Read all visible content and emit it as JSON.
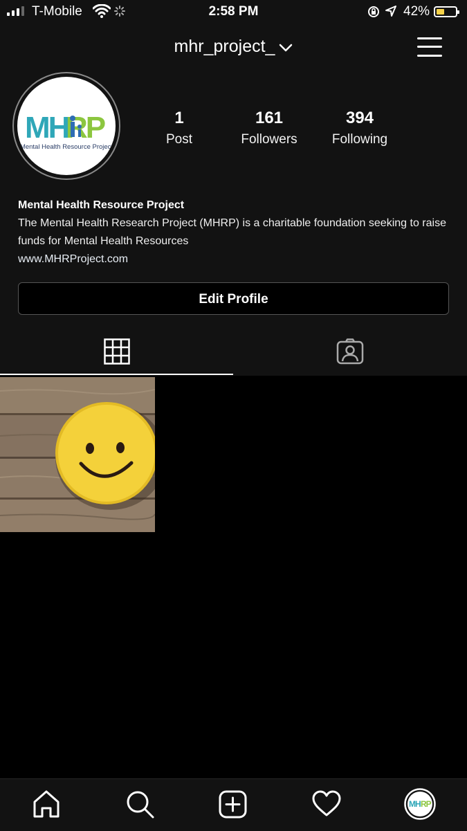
{
  "status_bar": {
    "carrier": "T-Mobile",
    "time": "2:58 PM",
    "battery": "42%",
    "battery_level": 0.42
  },
  "header": {
    "username": "mhr_project_"
  },
  "profile": {
    "avatar_logo": "MHRP",
    "avatar_caption": "Mental Health Resource Project",
    "stats": [
      {
        "value": "1",
        "label": "Post"
      },
      {
        "value": "161",
        "label": "Followers"
      },
      {
        "value": "394",
        "label": "Following"
      }
    ],
    "name": "Mental Health Resource Project",
    "bio": "The Mental Health Research Project (MHRP) is a charitable foundation seeking to raise funds for Mental Health Resources",
    "link": "www.MHRProject.com"
  },
  "actions": {
    "edit_profile": "Edit Profile"
  },
  "tabs": [
    {
      "icon": "grid-icon",
      "active": true
    },
    {
      "icon": "tagged-person-icon",
      "active": false
    }
  ],
  "posts": [
    {
      "image": "smiley-cookie-photo"
    }
  ],
  "bottom_nav": [
    {
      "icon": "home-icon"
    },
    {
      "icon": "search-icon"
    },
    {
      "icon": "new-post-icon"
    },
    {
      "icon": "heart-icon"
    },
    {
      "icon": "profile-avatar-icon"
    }
  ],
  "colors": {
    "background": "#121212",
    "grid_background": "#000000",
    "logo_teal": "#2fa7b8",
    "logo_green": "#8cc63f",
    "smiley_yellow": "#f4d13a"
  }
}
